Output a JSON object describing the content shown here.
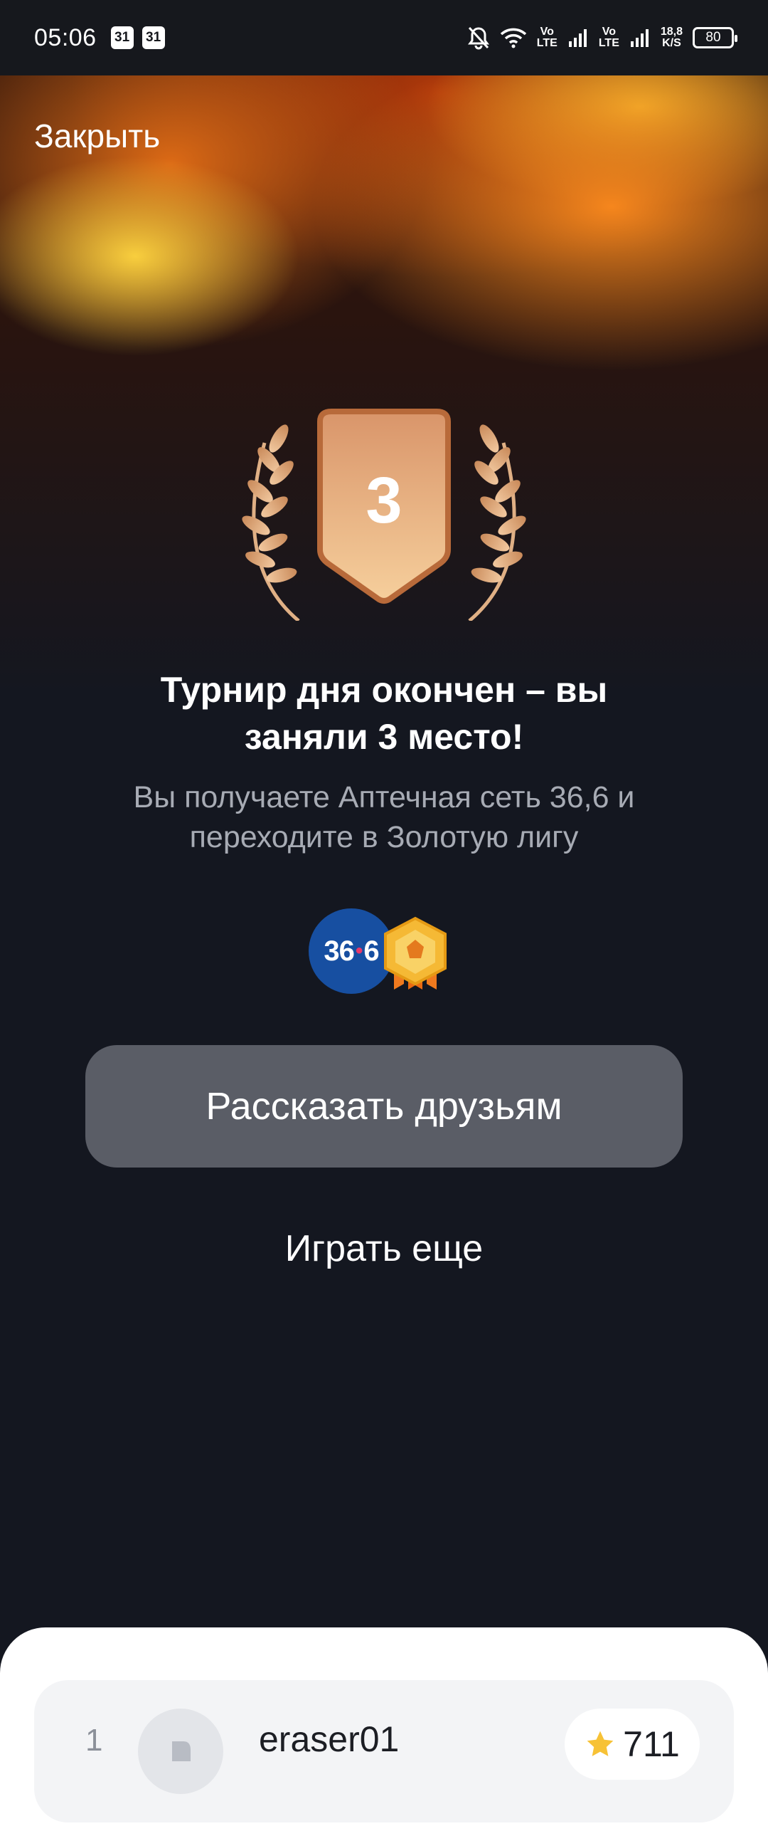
{
  "status_bar": {
    "time": "05:06",
    "calendar_badges": [
      "31",
      "31"
    ],
    "network_labels": [
      "Vo\nLTE",
      "Vo\nLTE"
    ],
    "speed": "18,8\nK/S",
    "battery": "80"
  },
  "header": {
    "close_label": "Закрыть"
  },
  "award": {
    "place": "3"
  },
  "result": {
    "title": "Турнир дня окончен – вы заняли 3 место!",
    "subtitle": "Вы получаете Аптечная сеть 36,6 и переходите в Золотую лигу"
  },
  "rewards": {
    "pharmacy_logo_left": "36",
    "pharmacy_logo_right": "6",
    "league_icon": "gold-league-badge-icon"
  },
  "actions": {
    "share_label": "Рассказать друзьям",
    "play_again_label": "Играть еще"
  },
  "leaderboard": {
    "rows": [
      {
        "rank": "1",
        "name": "eraser01",
        "score": "711"
      }
    ]
  },
  "colors": {
    "background": "#141720",
    "button": "#5a5d66",
    "bronze": "#e0a070",
    "pharmacy_blue": "#174fa1"
  }
}
